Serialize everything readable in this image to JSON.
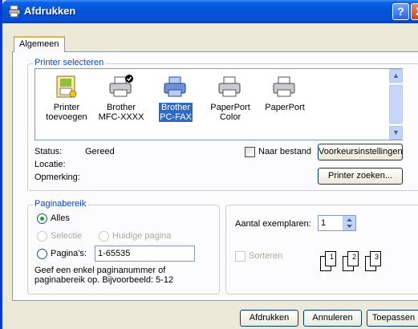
{
  "window": {
    "title": "Afdrukken",
    "help": "?",
    "close": "X"
  },
  "tabs": [
    {
      "label": "Algemeen"
    }
  ],
  "printer_select": {
    "legend": "Printer selecteren",
    "printers": [
      {
        "line1": "Printer",
        "line2": "toevoegen",
        "icon": "add-printer-icon"
      },
      {
        "line1": "Brother",
        "line2": "MFC-XXXX",
        "icon": "printer-default-icon"
      },
      {
        "line1": "Brother",
        "line2": "PC-FAX",
        "icon": "printer-icon",
        "selected": true
      },
      {
        "line1": "PaperPort",
        "line2": "Color",
        "icon": "printer-icon"
      },
      {
        "line1": "PaperPort",
        "line2": "",
        "icon": "printer-icon"
      }
    ],
    "status_label": "Status:",
    "status_value": "Gereed",
    "location_label": "Locatie:",
    "comment_label": "Opmerking:",
    "print_to_file": "Naar bestand",
    "preferences_button": "Voorkeursinstellingen",
    "find_printer_button": "Printer zoeken..."
  },
  "page_range": {
    "legend": "Paginabereik",
    "all": "Alles",
    "selection": "Selectie",
    "current_page": "Huidige pagina",
    "pages": "Pagina's:",
    "pages_value": "1-65535",
    "hint": "Geef een enkel paginanummer of paginabereik op. Bijvoorbeeld: 5-12"
  },
  "copies": {
    "label": "Aantal exemplaren:",
    "value": "1",
    "collate": "Sorteren",
    "collate_pages": [
      "1",
      "1",
      "2",
      "2",
      "3",
      "3"
    ]
  },
  "footer": {
    "print": "Afdrukken",
    "cancel": "Annuleren",
    "apply": "Toepassen"
  },
  "colors": {
    "title_blue": "#0553d6",
    "group_text": "#0046d5",
    "selected_highlight": "#316ac5"
  }
}
